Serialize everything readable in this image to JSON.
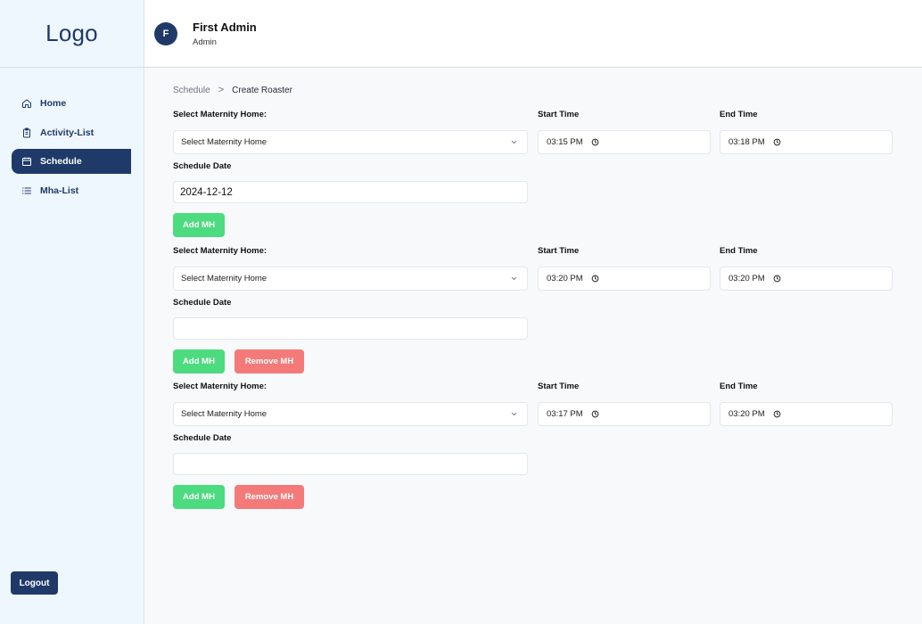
{
  "sidebar": {
    "logo": "Logo",
    "items": [
      {
        "label": "Home",
        "icon": "home-icon"
      },
      {
        "label": "Activity-List",
        "icon": "clipboard-icon"
      },
      {
        "label": "Schedule",
        "icon": "calendar-icon",
        "active": true
      },
      {
        "label": "Mha-List",
        "icon": "list-icon"
      }
    ],
    "logout_label": "Logout"
  },
  "header": {
    "avatar_initial": "F",
    "user_name": "First Admin",
    "user_role": "Admin"
  },
  "breadcrumb": {
    "parent": "Schedule",
    "separator": ">",
    "current": "Create Roaster"
  },
  "form_labels": {
    "maternity_home": "Select Maternity Home:",
    "start_time": "Start Time",
    "end_time": "End Time",
    "schedule_date": "Schedule Date",
    "add_button": "Add MH",
    "remove_button": "Remove MH"
  },
  "entries": [
    {
      "maternity_home": "Select Maternity Home",
      "start_time": "03:15 PM",
      "end_time": "03:18 PM",
      "schedule_date": "2024-12-12"
    },
    {
      "maternity_home": "Select Maternity Home",
      "start_time": "03:20 PM",
      "end_time": "03:20 PM",
      "schedule_date": ""
    },
    {
      "maternity_home": "Select Maternity Home",
      "start_time": "03:17 PM",
      "end_time": "03:20 PM",
      "schedule_date": ""
    }
  ],
  "colors": {
    "primary": "#1f3a68",
    "add_button": "#4ddb7f",
    "remove_button": "#f47a7a",
    "sidebar_bg": "#eef6fe"
  }
}
